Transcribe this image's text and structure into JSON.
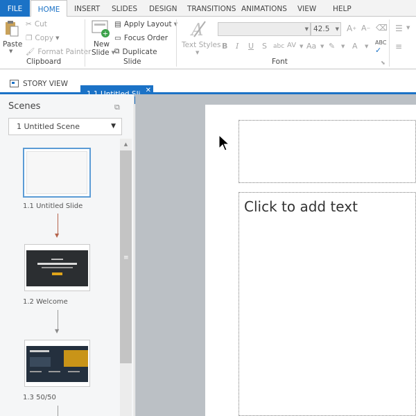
{
  "ribbon_tabs": [
    "FILE",
    "HOME",
    "INSERT",
    "SLIDES",
    "DESIGN",
    "TRANSITIONS",
    "ANIMATIONS",
    "VIEW",
    "HELP"
  ],
  "clipboard": {
    "paste": "Paste",
    "cut": "Cut",
    "copy": "Copy",
    "format_painter": "Format Painter",
    "group_label": "Clipboard"
  },
  "slide_group": {
    "new_slide_line1": "New",
    "new_slide_line2": "Slide",
    "apply_layout": "Apply Layout",
    "focus_order": "Focus Order",
    "duplicate": "Duplicate",
    "group_label": "Slide"
  },
  "font_group": {
    "text_styles": "Text Styles",
    "font_name": "",
    "font_size": "42.5",
    "group_label": "Font"
  },
  "view_tabs": {
    "story_view": "STORY VIEW",
    "slide_tab": "1.1 Untitled Sli..."
  },
  "scenes": {
    "title": "Scenes",
    "selected_scene": "1 Untitled Scene",
    "slides": [
      {
        "label": "1.1 Untitled Slide"
      },
      {
        "label": "1.2 Welcome"
      },
      {
        "label": "1.3 50/50"
      }
    ]
  },
  "canvas": {
    "body_placeholder": "Click to add text"
  },
  "colors": {
    "accent": "#1b72c6",
    "canvas_bg": "#bbc0c5",
    "panel_bg": "#f5f6f7"
  }
}
